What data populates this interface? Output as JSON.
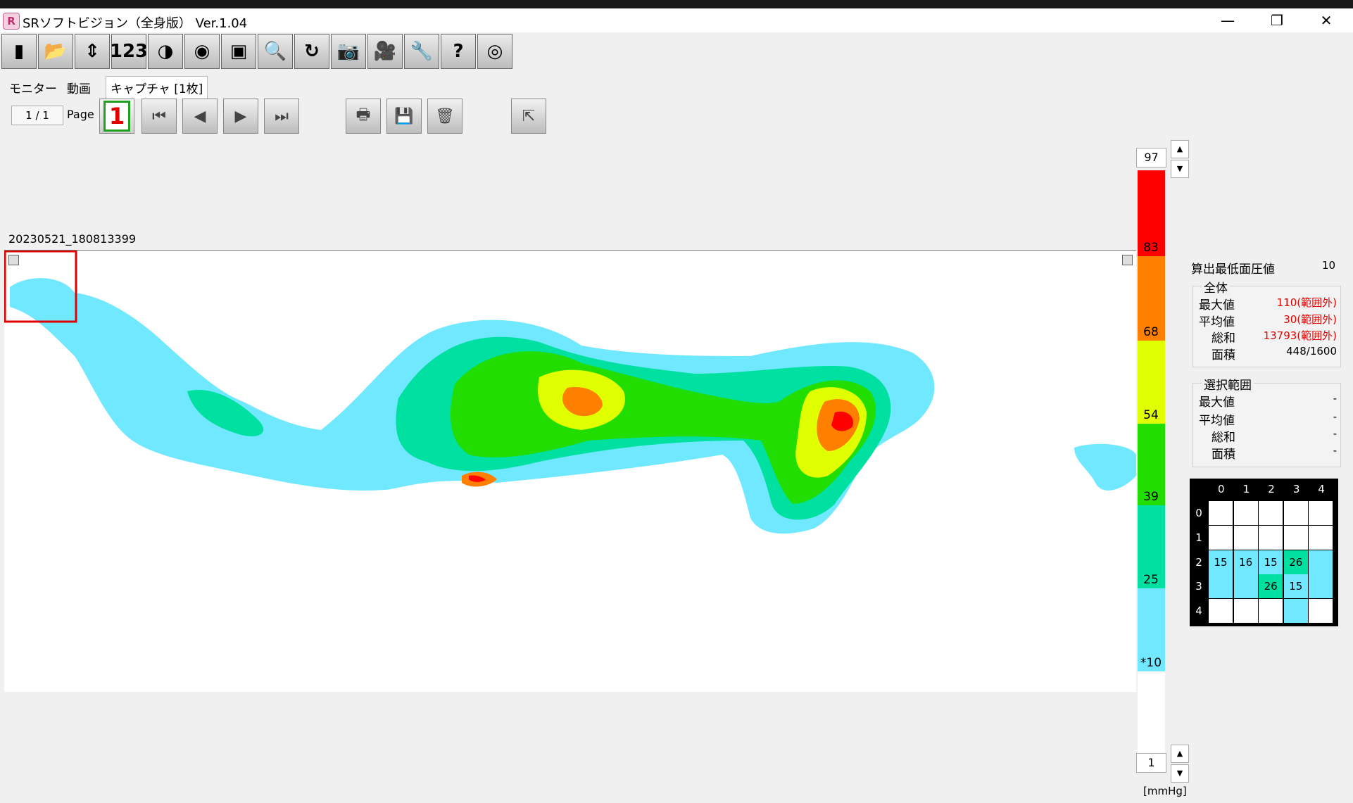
{
  "window": {
    "title": "SRソフトビジョン（全身版） Ver.1.04",
    "logo": "R",
    "minimize": "—",
    "restore": "❐",
    "close": "✕"
  },
  "toolbar": {
    "buttons": [
      {
        "name": "monitor-icon",
        "glyph": "▮"
      },
      {
        "name": "open-folder-icon",
        "glyph": "📂"
      },
      {
        "name": "up-down-arrows-icon",
        "glyph": "⇕"
      },
      {
        "name": "numbers-icon",
        "glyph": "123"
      },
      {
        "name": "quadrant-circle-icon",
        "glyph": "◑"
      },
      {
        "name": "color-wheel-icon",
        "glyph": "◉"
      },
      {
        "name": "frame-select-icon",
        "glyph": "▣"
      },
      {
        "name": "zoom-icon",
        "glyph": "🔍"
      },
      {
        "name": "rotate-icon",
        "glyph": "↻"
      },
      {
        "name": "camera-icon",
        "glyph": "📷"
      },
      {
        "name": "video-camera-icon",
        "glyph": "🎥"
      },
      {
        "name": "wrench-icon",
        "glyph": "🔧"
      },
      {
        "name": "help-icon",
        "glyph": "?"
      },
      {
        "name": "webcam-icon",
        "glyph": "◎"
      }
    ]
  },
  "tabs": [
    "モニター",
    "動画",
    "キャプチャ [1枚]"
  ],
  "pager": {
    "current": "1 / 1",
    "label": "Page",
    "page_button": "1"
  },
  "nav": {
    "first": "⏮",
    "prev": "◀",
    "next": "▶",
    "last": "⏭",
    "print": "🖶",
    "save": "💾",
    "delete": "🗑",
    "export": "⇱"
  },
  "capture": {
    "timestamp": "20230521_180813399"
  },
  "scale": {
    "max_value": "97",
    "min_value": "1",
    "unit": "[mmHg]",
    "labels": [
      "83",
      "68",
      "54",
      "39",
      "25",
      "*10"
    ],
    "colors": {
      "red": "#ff0000",
      "orange": "#ff8000",
      "yellow": "#e0ff00",
      "green": "#22dd00",
      "teal": "#00e0a0",
      "cyan": "#70e8ff",
      "white": "#ffffff"
    }
  },
  "stats": {
    "min_pressure_label": "算出最低面圧値",
    "min_pressure_value": "10",
    "overall": {
      "title": "全体",
      "rows": [
        {
          "label": "最大値",
          "value": "110(範囲外)",
          "alert": true
        },
        {
          "label": "平均値",
          "value": "30(範囲外)",
          "alert": true
        },
        {
          "label": "総和",
          "value": "13793(範囲外)",
          "alert": true
        },
        {
          "label": "面積",
          "value": "448/1600",
          "alert": false
        }
      ]
    },
    "selection": {
      "title": "選択範囲",
      "rows": [
        {
          "label": "最大値",
          "value": "-"
        },
        {
          "label": "平均値",
          "value": "-"
        },
        {
          "label": "総和",
          "value": "-"
        },
        {
          "label": "面積",
          "value": "-"
        }
      ]
    }
  },
  "grid": {
    "col_headers": [
      "0",
      "1",
      "2",
      "3",
      "4"
    ],
    "row_headers": [
      "0",
      "1",
      "2",
      "3",
      "4"
    ],
    "cells": [
      [
        "",
        "",
        "",
        "",
        ""
      ],
      [
        "",
        "",
        "",
        "",
        ""
      ],
      [
        "15",
        "16",
        "15",
        "26",
        ""
      ],
      [
        "",
        "",
        "26",
        "15",
        ""
      ],
      [
        "",
        "",
        "",
        "",
        ""
      ]
    ],
    "cell_colors": [
      [
        "#ffffff",
        "#ffffff",
        "#ffffff",
        "#ffffff",
        "#ffffff"
      ],
      [
        "#ffffff",
        "#ffffff",
        "#ffffff",
        "#ffffff",
        "#ffffff"
      ],
      [
        "#70e8ff",
        "#70e8ff",
        "#70e8ff",
        "#00e0a0",
        "#70e8ff"
      ],
      [
        "#70e8ff",
        "#70e8ff",
        "#00e0a0",
        "#70e8ff",
        "#70e8ff"
      ],
      [
        "#ffffff",
        "#ffffff",
        "#ffffff",
        "#70e8ff",
        "#ffffff"
      ]
    ]
  }
}
